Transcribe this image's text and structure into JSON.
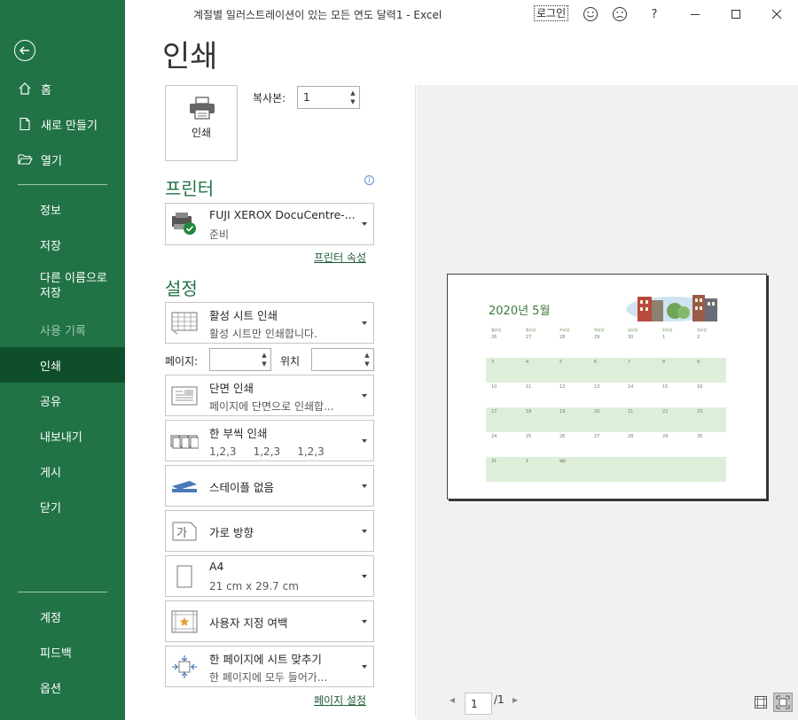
{
  "window": {
    "title": "계절별 일러스트레이션이 있는 모든 연도 달력1  -  Excel",
    "signin": "로그인",
    "help": "?"
  },
  "sidebar": {
    "items": [
      {
        "label": "홈"
      },
      {
        "label": "새로 만들기"
      },
      {
        "label": "열기"
      },
      {
        "label": "정보"
      },
      {
        "label": "저장"
      },
      {
        "label": "다른 이름으로 저장"
      },
      {
        "label": "사용 기록"
      },
      {
        "label": "인쇄"
      },
      {
        "label": "공유"
      },
      {
        "label": "내보내기"
      },
      {
        "label": "게시"
      },
      {
        "label": "닫기"
      },
      {
        "label": "계정"
      },
      {
        "label": "피드백"
      },
      {
        "label": "옵션"
      }
    ],
    "accent": "#217346",
    "active_bg": "#0f4e2a"
  },
  "print": {
    "title": "인쇄",
    "button_label": "인쇄",
    "copies_label": "복사본:",
    "copies_value": "1"
  },
  "printer": {
    "heading": "프린터",
    "name": "FUJI XEROX DocuCentre-...",
    "status": "준비",
    "properties_link": "프린터 속성"
  },
  "settings": {
    "heading": "설정",
    "what": {
      "line1": "활성 시트 인쇄",
      "line2": "활성 시트만 인쇄합니다."
    },
    "pages_label": "페이지:",
    "pages_value": "",
    "to_label": "위치",
    "to_value": "",
    "sides": {
      "line1": "단면 인쇄",
      "line2": "페이지에 단면으로 인쇄합..."
    },
    "collate": {
      "line1": "한 부씩 인쇄",
      "line2": "1,2,3     1,2,3     1,2,3"
    },
    "staple": {
      "line1": "스테이플 없음"
    },
    "orientation": {
      "line1": "가로 방향"
    },
    "paper": {
      "line1": "A4",
      "line2": "21 cm x 29.7 cm"
    },
    "margins": {
      "line1": "사용자 지정 여백"
    },
    "scaling": {
      "line1": "한 페이지에 시트 맞추기",
      "line2": "한 페이지에 모두 들어가..."
    },
    "page_setup_link": "페이지 설정"
  },
  "preview": {
    "calendar_title": "2020년 5월",
    "weekdays": [
      "월요일",
      "화요일",
      "수요일",
      "목요일",
      "금요일",
      "토요일",
      "일요일"
    ],
    "weeks": [
      [
        "26",
        "27",
        "28",
        "29",
        "30",
        "1",
        "2"
      ],
      [
        "3",
        "4",
        "5",
        "6",
        "7",
        "8",
        "9"
      ],
      [
        "10",
        "11",
        "12",
        "13",
        "14",
        "15",
        "16"
      ],
      [
        "17",
        "18",
        "19",
        "20",
        "21",
        "22",
        "23"
      ],
      [
        "24",
        "25",
        "26",
        "27",
        "28",
        "29",
        "30"
      ],
      [
        "31",
        "1",
        "메모",
        "",
        "",
        "",
        ""
      ]
    ],
    "band_color": "#deefd9"
  },
  "pager": {
    "current": "1",
    "total": "/1"
  }
}
